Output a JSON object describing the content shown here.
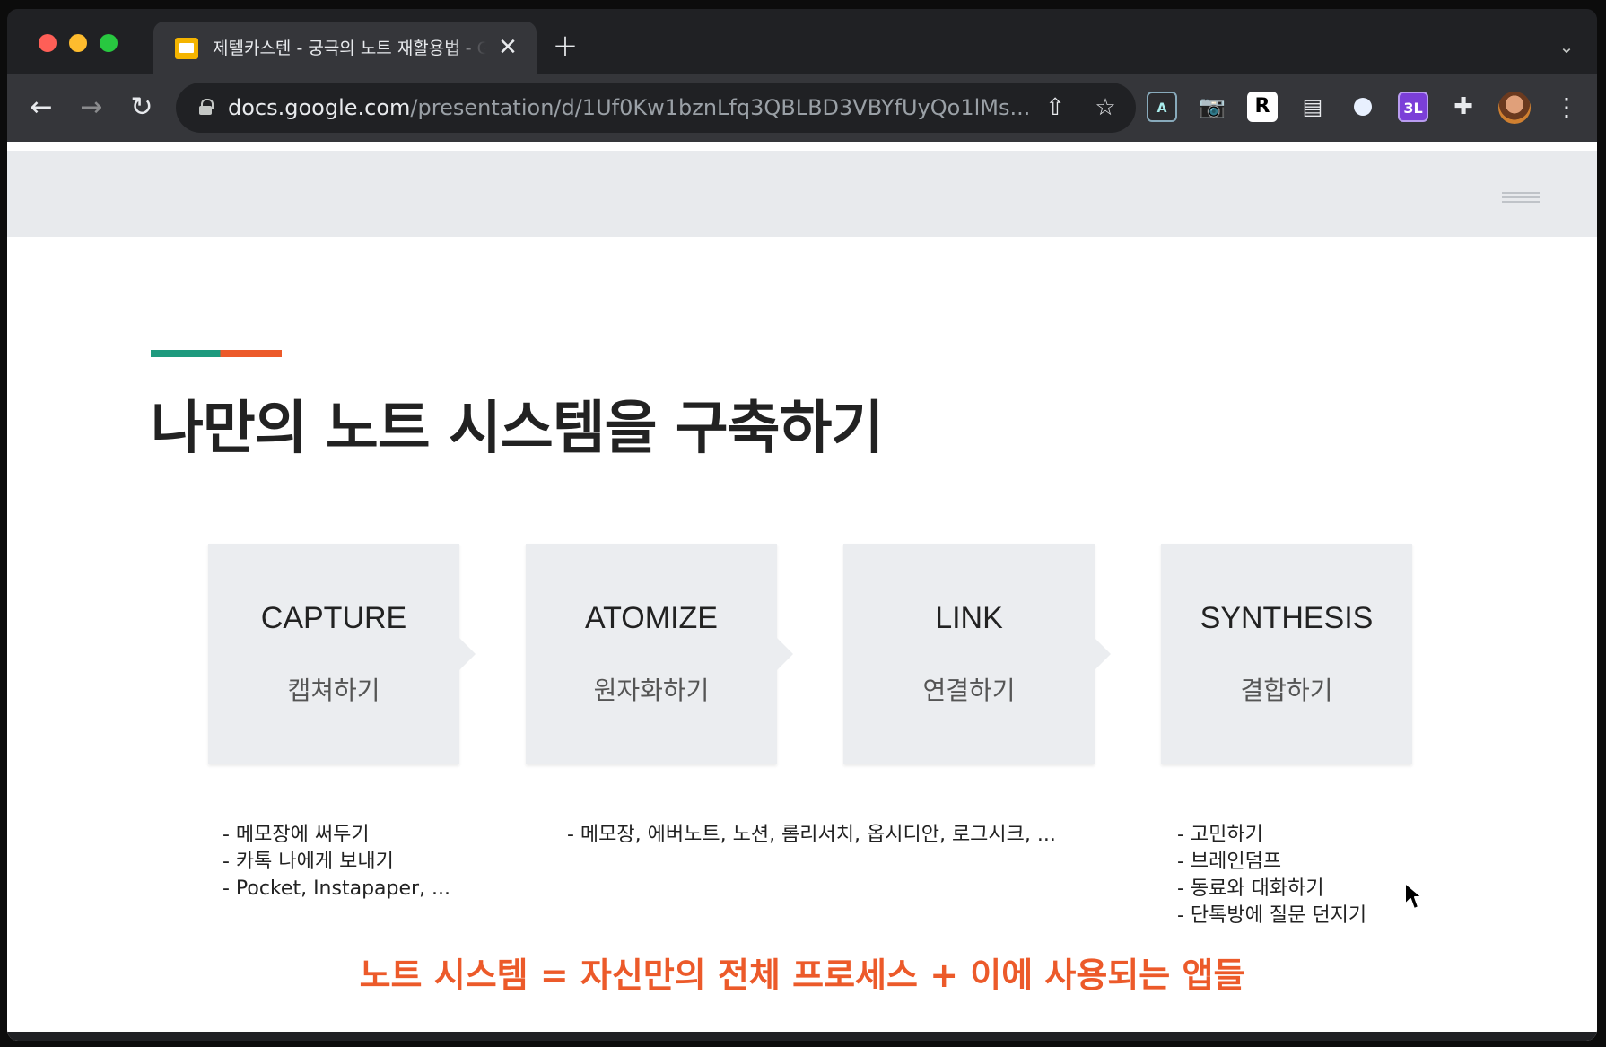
{
  "browser": {
    "tab": {
      "title": "제텔카스텐 - 궁극의 노트 재활용법 - Google Slides",
      "close_label": "✕"
    },
    "new_tab_label": "+",
    "url_host": "docs.google.com",
    "url_path": "/presentation/d/1Uf0Kw1bznLfq3QBLBD3VBYfUyQo1lMs...",
    "extensions": [
      "A",
      "R",
      "3L"
    ],
    "icons": {
      "back": "←",
      "forward": "→",
      "reload": "↻",
      "share": "⇧",
      "star": "☆",
      "camera": "📷",
      "extensions": "✚",
      "menu": "⋮",
      "tab_search": "⌄",
      "doc": "▤"
    }
  },
  "slide": {
    "title": "나만의 노트 시스템을 구축하기",
    "steps": [
      {
        "en": "CAPTURE",
        "ko": "캡쳐하기"
      },
      {
        "en": "ATOMIZE",
        "ko": "원자화하기"
      },
      {
        "en": "LINK",
        "ko": "연결하기"
      },
      {
        "en": "SYNTHESIS",
        "ko": "결합하기"
      }
    ],
    "capture_notes": [
      "- 메모장에 써두기",
      "- 카톡 나에게 보내기",
      "- Pocket, Instapaper, ..."
    ],
    "apps_note": "- 메모장, 에버노트, 노션, 롬리서치, 옵시디안, 로그시크, ...",
    "synthesis_notes": [
      "- 고민하기",
      "- 브레인덤프",
      "- 동료와 대화하기",
      "- 단톡방에 질문 던지기"
    ],
    "summary": "노트 시스템 = 자신만의 전체 프로세스 + 이에 사용되는 앱들"
  },
  "colors": {
    "accent_green": "#1e9a7e",
    "accent_orange": "#ec5a2a",
    "step_box": "#ebedf0"
  }
}
